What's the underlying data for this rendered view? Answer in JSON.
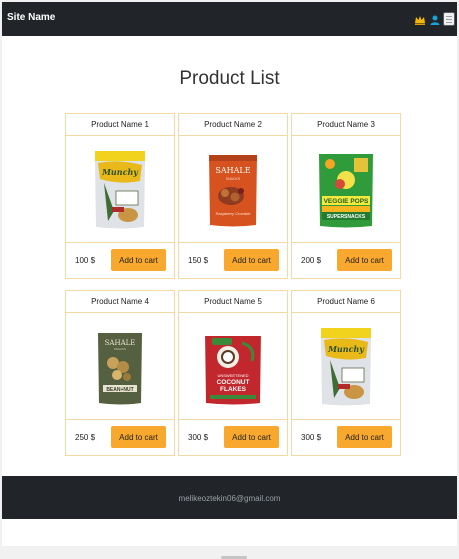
{
  "navbar": {
    "brand": "Site Name",
    "icons": [
      "crown-icon",
      "user-icon",
      "menu-icon"
    ],
    "colors": {
      "background": "#212529",
      "crown": "#f5b800",
      "user": "#17a2d8"
    }
  },
  "page": {
    "title": "Product List"
  },
  "products": [
    {
      "name": "Product Name 1",
      "price": "100 $",
      "button": "Add to cart",
      "image": "snack-bag-white-yellow-product-image"
    },
    {
      "name": "Product Name 2",
      "price": "150 $",
      "button": "Add to cart",
      "image": "snack-bag-orange-product-image"
    },
    {
      "name": "Product Name 3",
      "price": "200 $",
      "button": "Add to cart",
      "image": "snack-bag-green-product-image"
    },
    {
      "name": "Product Name 4",
      "price": "250 $",
      "button": "Add to cart",
      "image": "snack-bag-olive-product-image"
    },
    {
      "name": "Product Name 5",
      "price": "300 $",
      "button": "Add to cart",
      "image": "coconut-flakes-bag-product-image"
    },
    {
      "name": "Product Name 6",
      "price": "300 $",
      "button": "Add to cart",
      "image": "snack-bag-white-yellow-product-image"
    }
  ],
  "footer": {
    "email": "melikeoztekin06@gmail.com"
  },
  "colors": {
    "accent": "#f7a82d",
    "card_border": "#f3d9a4",
    "footer_bg": "#212529"
  }
}
